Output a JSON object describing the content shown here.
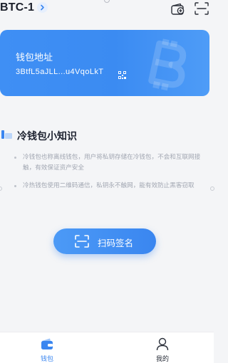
{
  "header": {
    "wallet_name": "BTC-1",
    "icons": [
      "chevron-right-icon",
      "wallet-add-icon",
      "scan-icon"
    ]
  },
  "card": {
    "title": "钱包地址",
    "address": "3BtfL5aJLL...u4VqoLkT",
    "icons": [
      "qr-code-icon",
      "bitcoin-watermark-icon"
    ],
    "gradient_start": "#3f8ff4",
    "gradient_end": "#4e9cf7"
  },
  "tips_section": {
    "title": "冷钱包小知识",
    "items": [
      "冷钱包也称离线钱包，用户将私钥存储在冷钱包，不会和互联网接触，有效保证资产安全",
      "冷热钱包使用二维码通信，私钥永不触网，能有效防止黑客窃取"
    ]
  },
  "sign_button": {
    "label": "扫码签名",
    "icon": "scan-frame-icon"
  },
  "bottom_nav": {
    "items": [
      {
        "label": "钱包",
        "icon": "wallet-icon",
        "active": true
      },
      {
        "label": "我的",
        "icon": "user-icon",
        "active": false
      }
    ]
  },
  "colors": {
    "accent": "#3a86f0",
    "background": "#f4f5f7",
    "muted_text": "#a2a7b2"
  }
}
